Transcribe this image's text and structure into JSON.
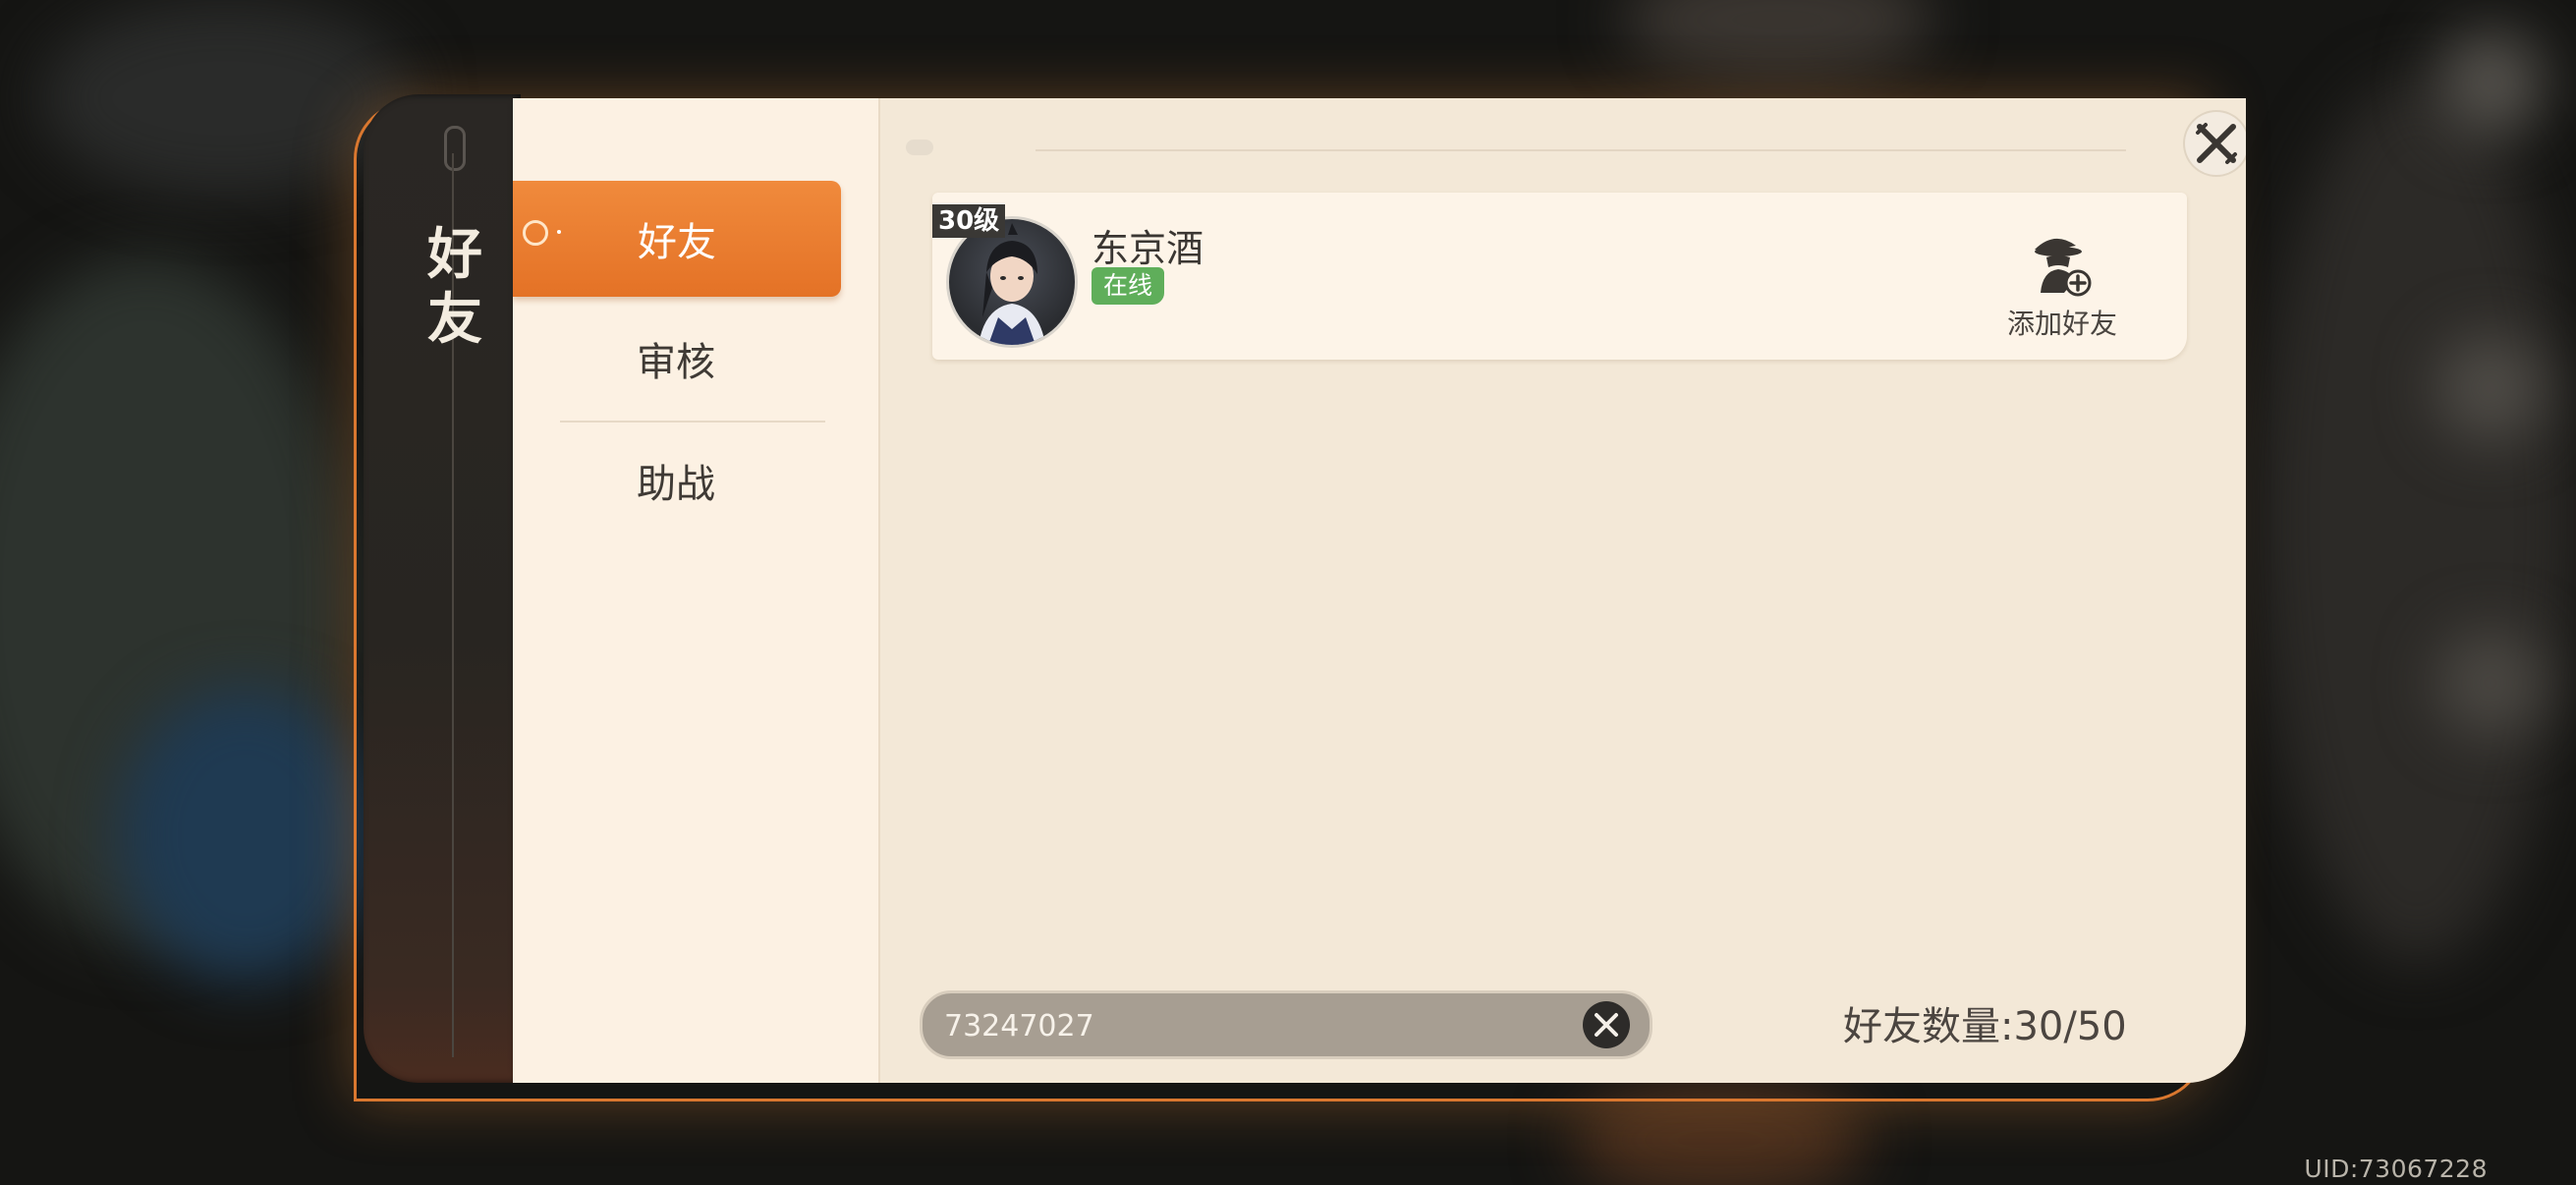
{
  "panel": {
    "title": "好友"
  },
  "nav": {
    "items": [
      {
        "label": "好友",
        "active": true
      },
      {
        "label": "审核",
        "active": false
      },
      {
        "label": "助战",
        "active": false
      }
    ]
  },
  "friend": {
    "level": "30级",
    "name": "东京酒",
    "status": "在线",
    "add_label": "添加好友"
  },
  "search": {
    "value": "73247027"
  },
  "friend_count": "好友数量:30/50",
  "uid": "UID:73067228",
  "colors": {
    "accent": "#e47226",
    "online": "#5fae5a"
  }
}
